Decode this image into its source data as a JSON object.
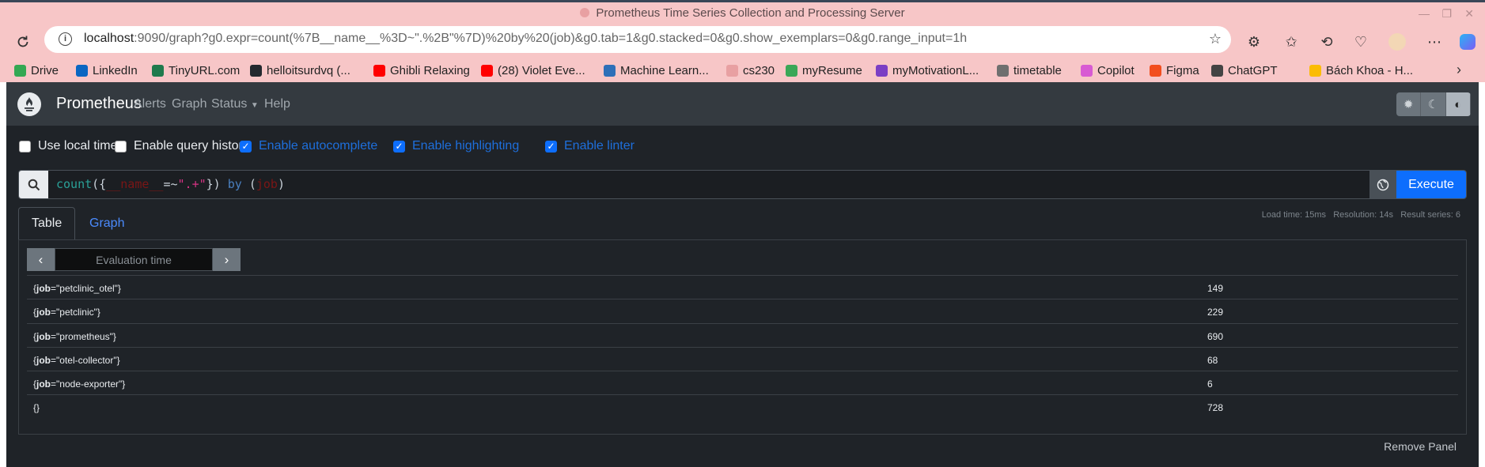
{
  "window": {
    "title": "Prometheus Time Series Collection and Processing Server"
  },
  "browser": {
    "url_host": "localhost",
    "url_rest": ":9090/graph?g0.expr=count(%7B__name__%3D~\".%2B\"%7D)%20by%20(job)&g0.tab=1&g0.stacked=0&g0.show_exemplars=0&g0.range_input=1h",
    "bookmarks": [
      {
        "label": "Drive",
        "color": "#34a853"
      },
      {
        "label": "LinkedIn",
        "color": "#0a66c2"
      },
      {
        "label": "TinyURL.com",
        "color": "#1f7a4c"
      },
      {
        "label": "helloitsurdvq (...",
        "color": "#24292f"
      },
      {
        "label": "Ghibli Relaxing",
        "color": "#ff0000"
      },
      {
        "label": "(28) Violet Eve...",
        "color": "#ff0000"
      },
      {
        "label": "Machine Learn...",
        "color": "#2e6fb8"
      },
      {
        "label": "cs230",
        "color": "#e8a0a2"
      },
      {
        "label": "myResume",
        "color": "#3aa757"
      },
      {
        "label": "myMotivationL...",
        "color": "#7b3fc4"
      },
      {
        "label": "timetable",
        "color": "#6f6f6f"
      },
      {
        "label": "Copilot",
        "color": "#d85bd3"
      },
      {
        "label": "Figma",
        "color": "#f24e1e"
      },
      {
        "label": "ChatGPT",
        "color": "#444444"
      },
      {
        "label": "Bách Khoa - H...",
        "color": "#fbbc04"
      }
    ]
  },
  "app": {
    "brand": "Prometheus",
    "nav": [
      "Alerts",
      "Graph",
      "Status",
      "Help"
    ],
    "options": [
      {
        "label": "Use local time",
        "checked": false
      },
      {
        "label": "Enable query history",
        "checked": false
      },
      {
        "label": "Enable autocomplete",
        "checked": true
      },
      {
        "label": "Enable highlighting",
        "checked": true
      },
      {
        "label": "Enable linter",
        "checked": true
      }
    ],
    "query": {
      "fn": "count",
      "label_name": "__name__",
      "op": "=~",
      "string": "\".+\"",
      "keyword": "by",
      "group_label": "job"
    },
    "execute_label": "Execute",
    "stats": {
      "load_time": "Load time: 15ms",
      "resolution": "Resolution: 14s",
      "result_series": "Result series: 6"
    },
    "tabs": [
      "Table",
      "Graph"
    ],
    "eval_placeholder": "Evaluation time",
    "results": [
      {
        "job": "petclinic_otel",
        "value": "149"
      },
      {
        "job": "petclinic",
        "value": "229"
      },
      {
        "job": "prometheus",
        "value": "690"
      },
      {
        "job": "otel-collector",
        "value": "68"
      },
      {
        "job": "node-exporter",
        "value": "6"
      },
      {
        "job": "",
        "value": "728"
      }
    ],
    "remove_panel": "Remove Panel"
  },
  "colors": {
    "app_bg": "#1f2328",
    "nav_bg": "#343a40",
    "accent": "#0d6efd",
    "browser_chrome": "#f7c6c7"
  }
}
